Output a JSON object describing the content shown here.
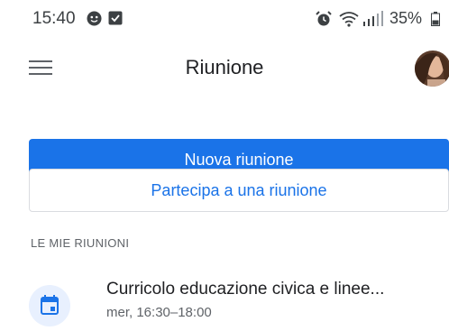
{
  "status_bar": {
    "time": "15:40",
    "battery": "35%",
    "icons": [
      "face-notification-icon",
      "check-notification-icon",
      "alarm-icon",
      "wifi-icon",
      "signal-icon",
      "battery-icon"
    ]
  },
  "app_bar": {
    "title": "Riunione"
  },
  "actions": {
    "new_meeting": "Nuova riunione",
    "join_meeting": "Partecipa a una riunione"
  },
  "section": {
    "header": "LE MIE RIUNIONI"
  },
  "meetings": [
    {
      "title": "Curricolo educazione civica e linee...",
      "time": "mer, 16:30–18:00",
      "icon": "calendar-icon"
    }
  ],
  "colors": {
    "accent": "#1a73e8",
    "icon_bg": "#e8f0fe"
  }
}
